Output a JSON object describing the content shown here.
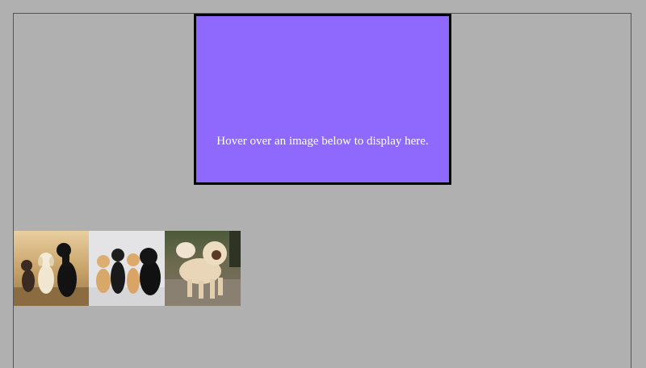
{
  "display": {
    "message": "Hover over an image below to display here.",
    "background_color": "#8f69fe",
    "border_color": "#000000"
  },
  "page": {
    "background_color": "#b0b0b0"
  },
  "gallery": {
    "thumbnails": [
      {
        "name": "dog-photo-retriever-puppies",
        "subject": "three retriever puppies"
      },
      {
        "name": "dog-photo-sharpei-chow-puppies",
        "subject": "four puppies"
      },
      {
        "name": "dog-photo-chow-chow",
        "subject": "cream chow chow"
      }
    ]
  }
}
